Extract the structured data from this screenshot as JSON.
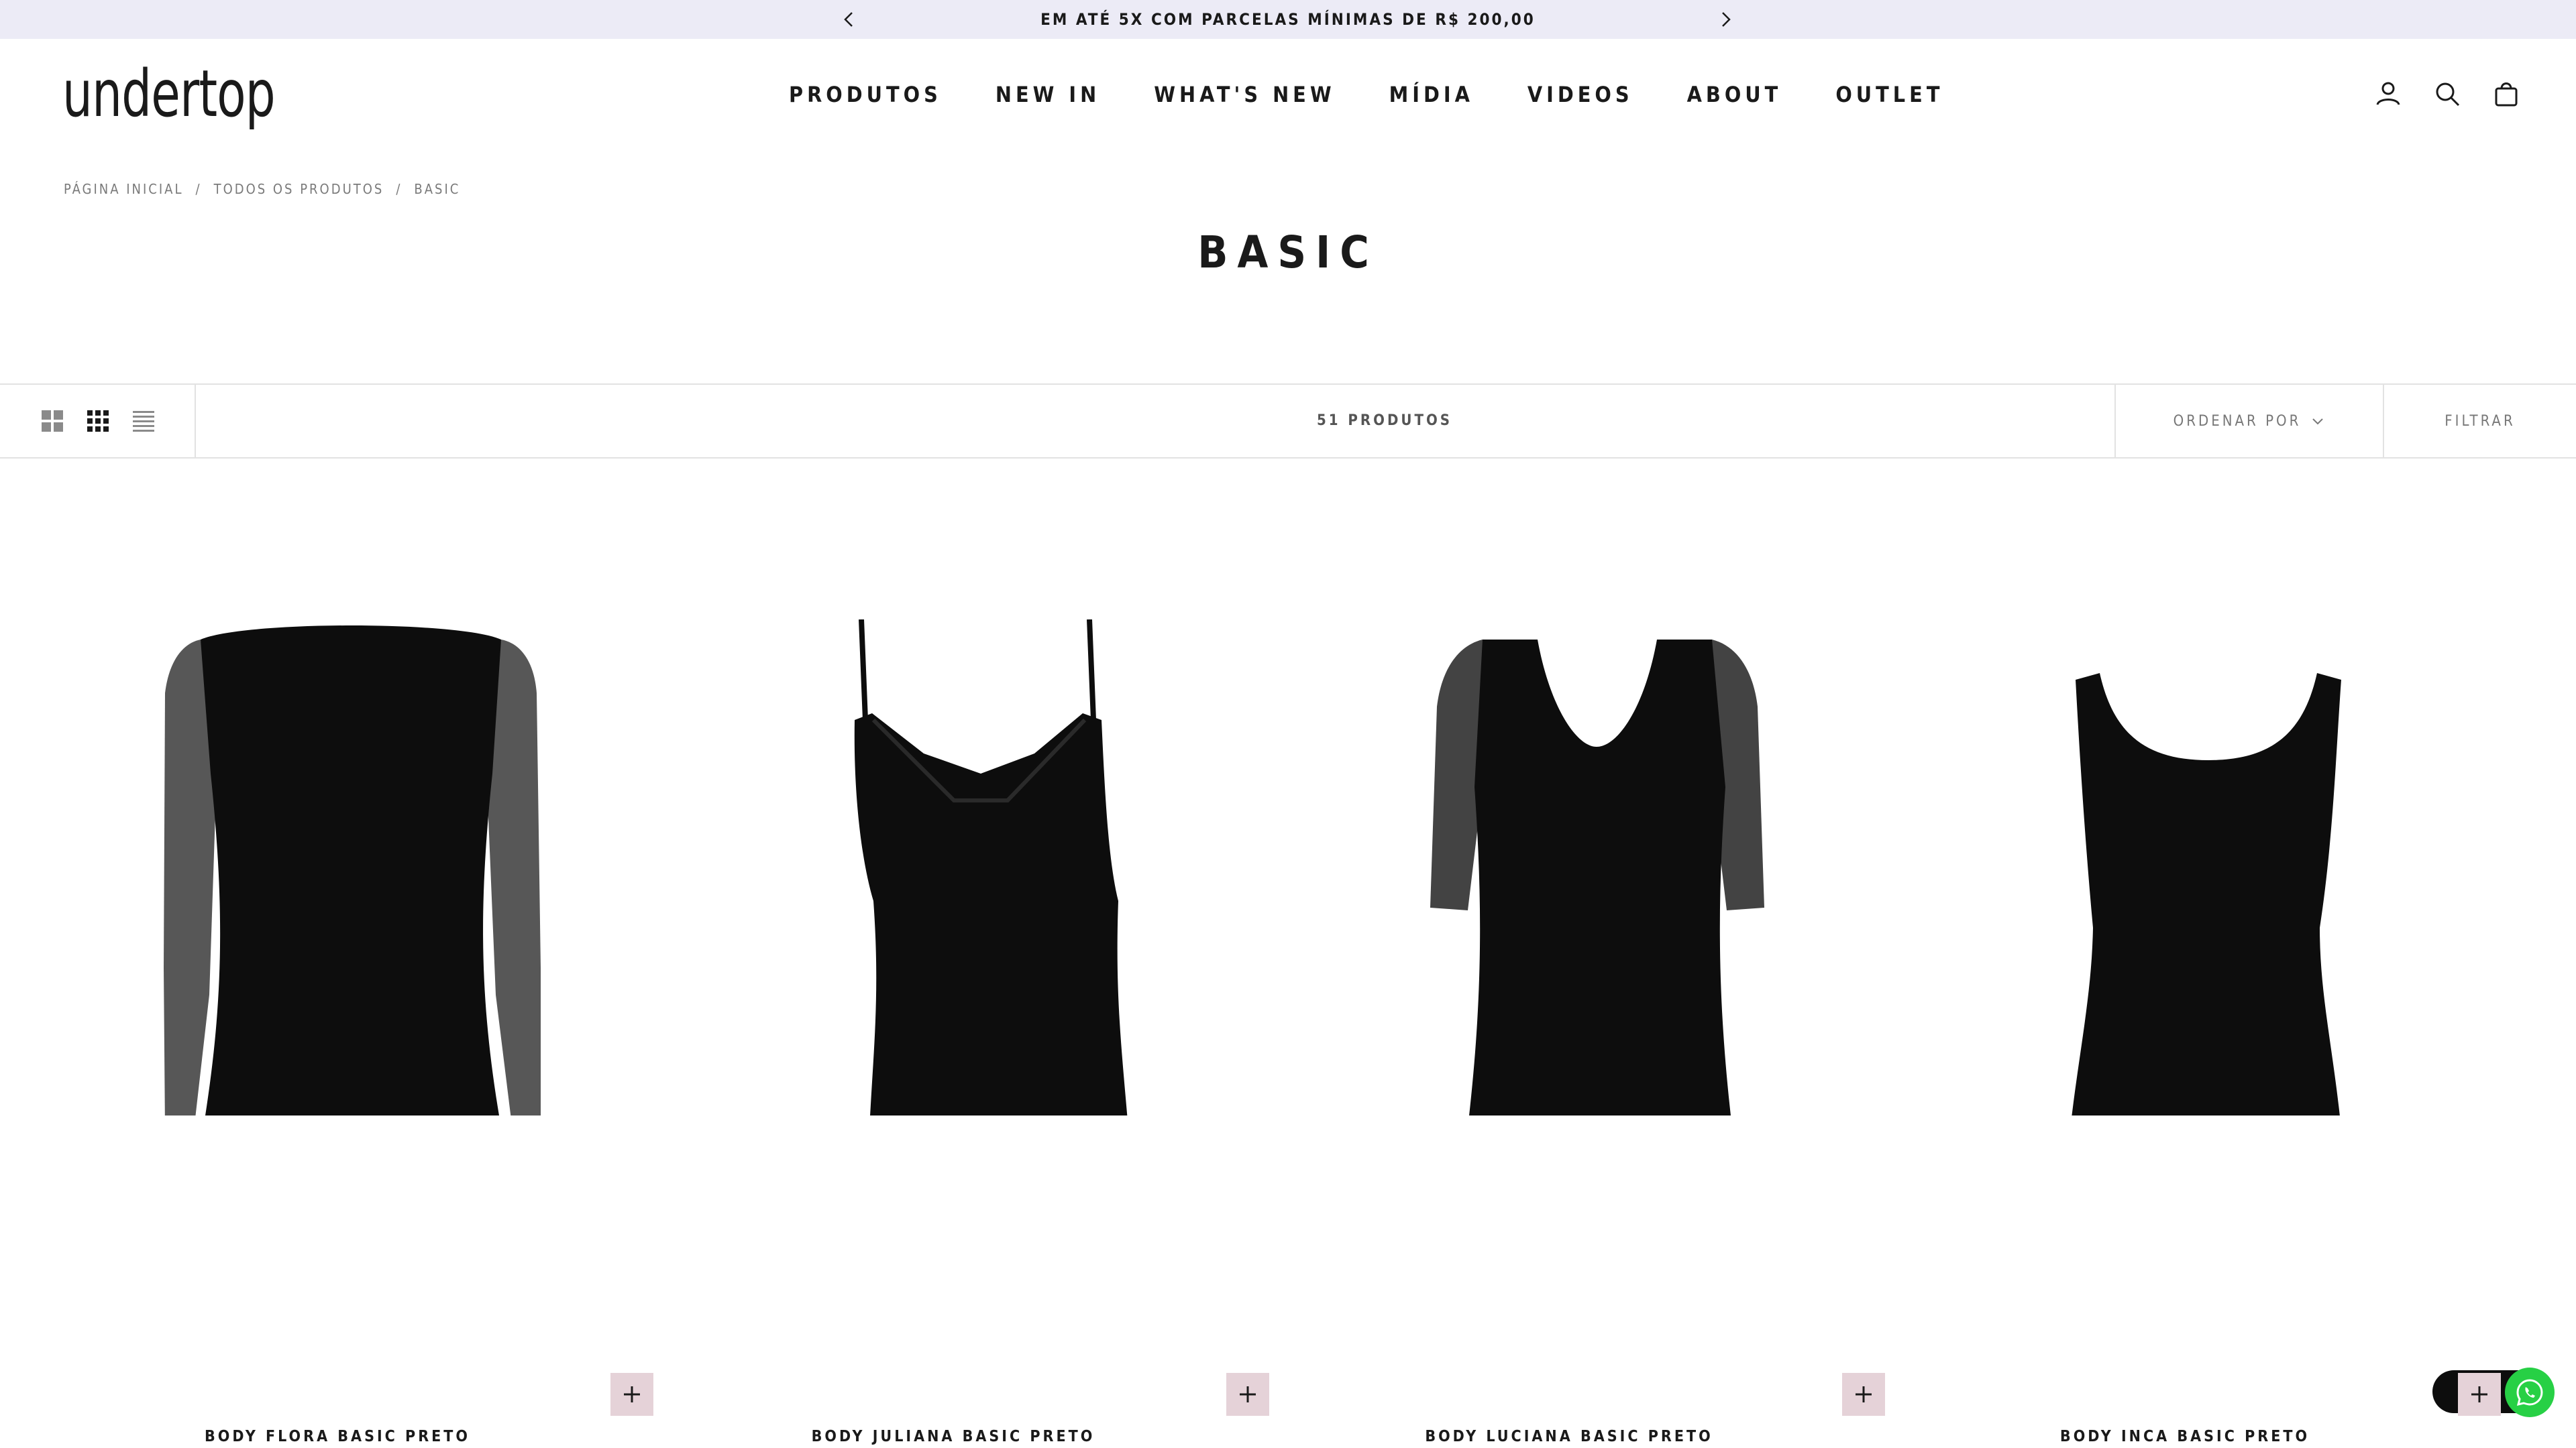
{
  "announcement": {
    "text": "EM ATÉ 5X COM PARCELAS MÍNIMAS DE R$ 200,00"
  },
  "header": {
    "logo": "undertop",
    "nav": [
      "PRODUTOS",
      "NEW IN",
      "WHAT'S NEW",
      "MÍDIA",
      "VIDEOS",
      "ABOUT",
      "OUTLET"
    ]
  },
  "breadcrumb": [
    "PÁGINA INICIAL",
    "TODOS OS PRODUTOS",
    "BASIC"
  ],
  "collection": {
    "title": "BASIC"
  },
  "toolbar": {
    "product_count": "51 PRODUTOS",
    "sort_label": "ORDENAR POR",
    "filter_label": "FILTRAR"
  },
  "products": [
    {
      "name": "BODY FLORA BASIC PRETO"
    },
    {
      "name": "BODY JULIANA BASIC PRETO"
    },
    {
      "name": "BODY LUCIANA BASIC PRETO"
    },
    {
      "name": "BODY INCA BASIC PRETO"
    }
  ],
  "colors": {
    "announcement_bg": "#ecebf6",
    "quick_add_bg": "#e5d2d8",
    "whatsapp": "#27d045",
    "text": "#1a1a1a"
  }
}
